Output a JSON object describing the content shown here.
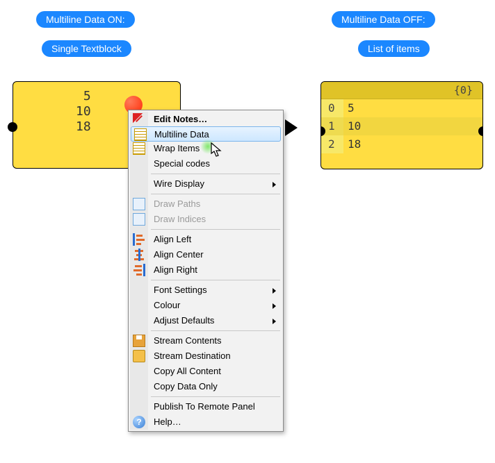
{
  "labels": {
    "on_title": "Multiline Data ON:",
    "on_sub": "Single Textblock",
    "off_title": "Multiline Data OFF:",
    "off_sub": "List of items"
  },
  "left_panel": {
    "text": " 5\n10\n18"
  },
  "right_panel": {
    "header": "{0}",
    "rows": [
      {
        "index": "0",
        "value": "5"
      },
      {
        "index": "1",
        "value": "10"
      },
      {
        "index": "2",
        "value": "18"
      }
    ]
  },
  "menu": {
    "edit_notes": "Edit Notes…",
    "multiline": "Multiline Data",
    "wrap": "Wrap Items",
    "special": "Special codes",
    "wire": "Wire Display",
    "draw_paths": "Draw Paths",
    "draw_indices": "Draw Indices",
    "align_left": "Align Left",
    "align_center": "Align Center",
    "align_right": "Align Right",
    "font": "Font Settings",
    "colour": "Colour",
    "adjust": "Adjust Defaults",
    "stream_c": "Stream Contents",
    "stream_d": "Stream Destination",
    "copy_all": "Copy All Content",
    "copy_data": "Copy Data Only",
    "publish": "Publish To Remote Panel",
    "help": "Help…"
  }
}
